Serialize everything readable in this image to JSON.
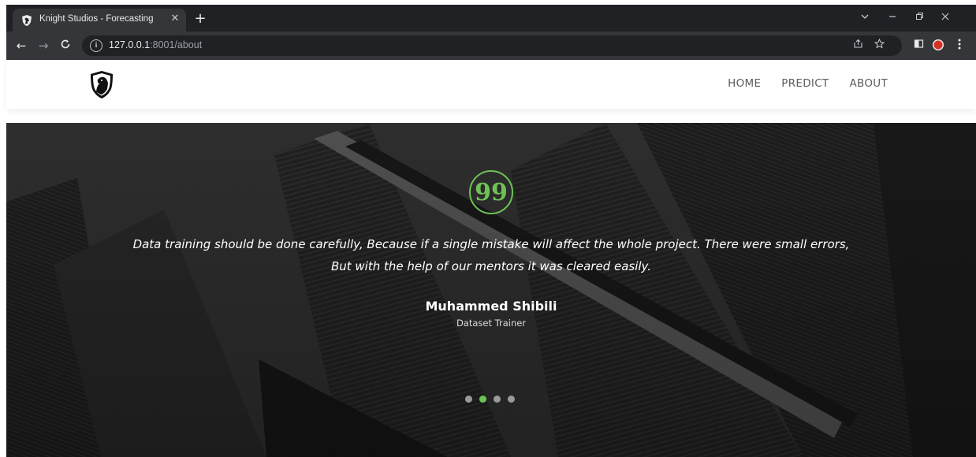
{
  "browser": {
    "tab_title": "Knight Studios - Forecasting",
    "tab_close": "✕",
    "new_tab": "+",
    "url_host": "127.0.0.1",
    "url_rest": ":8001/about",
    "back": "←",
    "forward": "→",
    "reload": "C",
    "info": "i"
  },
  "site": {
    "nav": [
      "HOME",
      "PREDICT",
      "ABOUT"
    ]
  },
  "testimonial": {
    "quote_mark": "99",
    "text": "Data training should be done carefully, Because if a single mistake will affect the whole project. There were small errors, But with the help of our mentors it was cleared easily.",
    "author": "Muhammed Shibili",
    "role": "Dataset Trainer",
    "slide_count": 4,
    "active_slide": 2
  },
  "colors": {
    "accent": "#6fc156",
    "chrome_dark": "#202124",
    "chrome_toolbar": "#35363a"
  }
}
